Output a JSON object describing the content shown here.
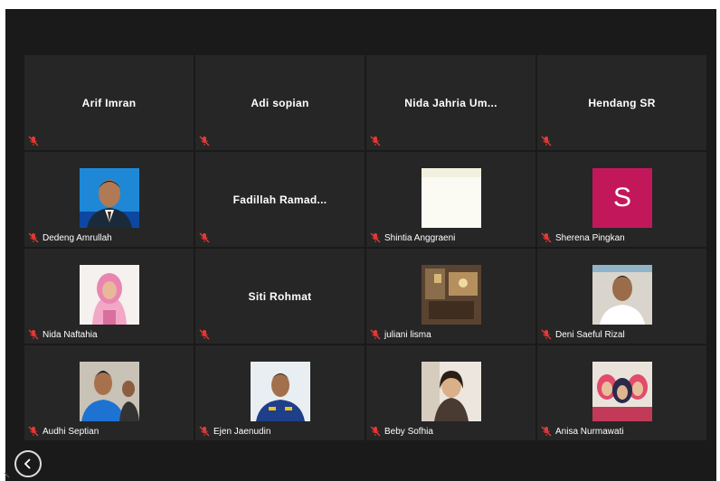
{
  "participants": [
    {
      "name": "Arif Imran",
      "mode": "name"
    },
    {
      "name": "Adi sopian",
      "mode": "name"
    },
    {
      "name": "Nida Jahria Um...",
      "mode": "name"
    },
    {
      "name": "Hendang SR",
      "mode": "name"
    },
    {
      "name": "Dedeng Amrullah",
      "mode": "photo",
      "photo": "man-in-suit-blue-bg"
    },
    {
      "name": "Fadillah  Ramad...",
      "mode": "name"
    },
    {
      "name": "Shintia Anggraeni",
      "mode": "photo",
      "photo": "blank-light"
    },
    {
      "name": "Sherena Pingkan",
      "mode": "initial",
      "initial": "S",
      "color": "#c2185b"
    },
    {
      "name": "Nida Naftahia",
      "mode": "photo",
      "photo": "woman-hijab-pink"
    },
    {
      "name": "Siti Rohmat",
      "mode": "name"
    },
    {
      "name": "juliani lisma",
      "mode": "photo",
      "photo": "room-interior"
    },
    {
      "name": "Deni Saeful Rizal",
      "mode": "photo",
      "photo": "man-white-shirt"
    },
    {
      "name": "Audhi Septian",
      "mode": "photo",
      "photo": "man-blue-shirt"
    },
    {
      "name": "Ejen Jaenudin",
      "mode": "photo",
      "photo": "man-uniform"
    },
    {
      "name": "Beby Sofhia",
      "mode": "photo",
      "photo": "woman-selfie"
    },
    {
      "name": "Anisa Nurmawati",
      "mode": "photo",
      "photo": "group-selfie"
    }
  ],
  "colors": {
    "background": "#1a1a1a",
    "tile": "#262626",
    "muted_mic": "#e53935"
  },
  "icons": {
    "muted_mic": "microphone-muted-icon",
    "back": "chevron-left-icon"
  }
}
